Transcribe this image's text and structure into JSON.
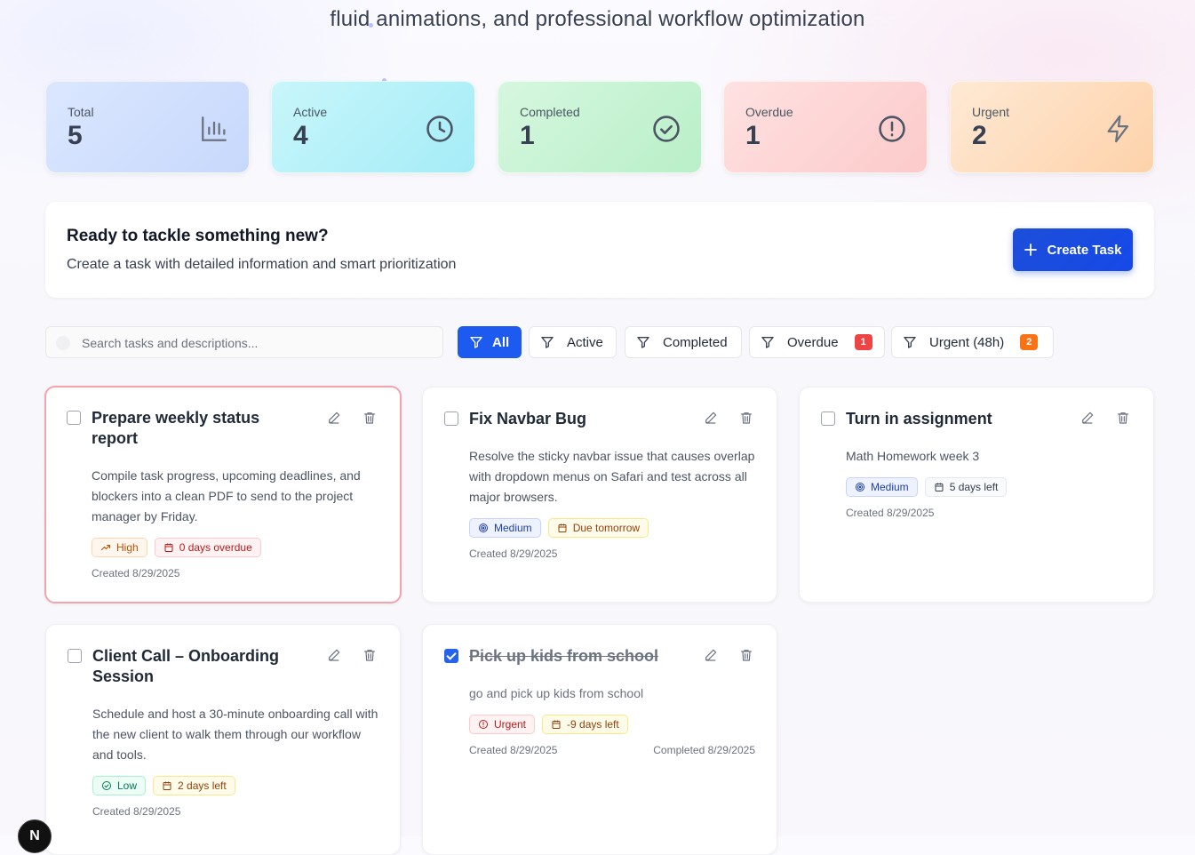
{
  "header": {
    "subtitle": "fluid animations, and professional workflow optimization"
  },
  "stats": [
    {
      "label": "Total",
      "value": "5",
      "icon": "bar-chart-icon"
    },
    {
      "label": "Active",
      "value": "4",
      "icon": "clock-icon"
    },
    {
      "label": "Completed",
      "value": "1",
      "icon": "check-circle-icon"
    },
    {
      "label": "Overdue",
      "value": "1",
      "icon": "alert-circle-icon"
    },
    {
      "label": "Urgent",
      "value": "2",
      "icon": "lightning-icon"
    }
  ],
  "create": {
    "title": "Ready to tackle something new?",
    "subtitle": "Create a task with detailed information and smart prioritization",
    "button": "Create Task"
  },
  "search": {
    "placeholder": "Search tasks and descriptions..."
  },
  "filters": [
    {
      "label": "All",
      "active": true
    },
    {
      "label": "Active"
    },
    {
      "label": "Completed"
    },
    {
      "label": "Overdue",
      "count": "1"
    },
    {
      "label": "Urgent (48h)",
      "count": "2"
    }
  ],
  "tasks": [
    {
      "title": "Prepare weekly status report",
      "description": "Compile task progress, upcoming deadlines, and blockers into a clean PDF to send to the project manager by Friday.",
      "priority": "High",
      "due": "0 days overdue",
      "created": "Created 8/29/2025",
      "completed": false
    },
    {
      "title": "Fix Navbar Bug",
      "description": "Resolve the sticky navbar issue that causes overlap with dropdown menus on Safari and test across all major browsers.",
      "priority": "Medium",
      "due": "Due tomorrow",
      "created": "Created 8/29/2025",
      "completed": false
    },
    {
      "title": "Turn in assignment",
      "description": "Math Homework week 3",
      "priority": "Medium",
      "due": "5 days left",
      "created": "Created 8/29/2025",
      "completed": false
    },
    {
      "title": "Client Call – Onboarding Session",
      "description": "Schedule and host a 30-minute onboarding call with the new client to walk them through our workflow and tools.",
      "priority": "Low",
      "due": "2 days left",
      "created": "Created 8/29/2025",
      "completed": false
    },
    {
      "title": "Pick up kids from school",
      "description": "go and pick up kids from school",
      "priority": "Urgent",
      "due": "-9 days left",
      "created": "Created 8/29/2025",
      "completed_at": "Completed 8/29/2025",
      "completed": true
    }
  ],
  "badge": {
    "letter": "N"
  }
}
